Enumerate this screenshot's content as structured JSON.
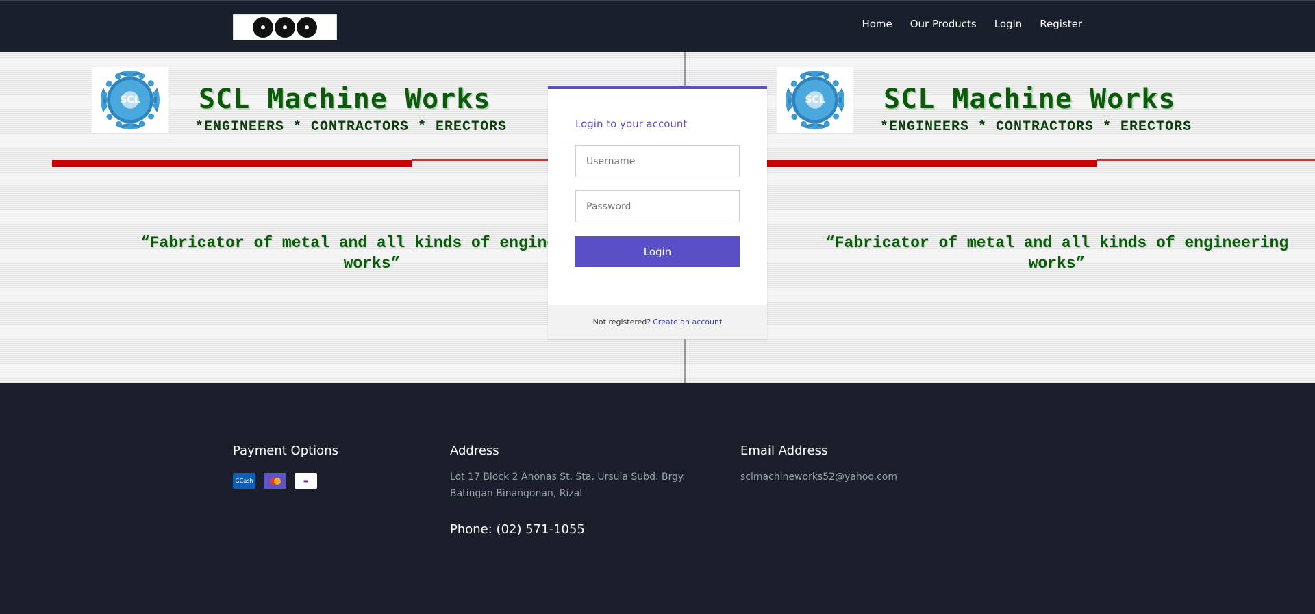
{
  "nav": {
    "items": [
      {
        "label": "Home"
      },
      {
        "label": "Our Products"
      },
      {
        "label": "Login"
      },
      {
        "label": "Register"
      }
    ]
  },
  "hero": {
    "title": "SCL Machine Works",
    "subtitle": "*ENGINEERS * CONTRACTORS * ERECTORS",
    "quote": "“Fabricator of metal and all kinds of engineering works”",
    "badge_text": "SCL"
  },
  "login": {
    "heading": "Login to your account",
    "username_placeholder": "Username",
    "password_placeholder": "Password",
    "button_label": "Login",
    "footer_text": "Not registered?",
    "footer_link": "Create an account",
    "accent_color": "#5b4fc8"
  },
  "footer": {
    "payment": {
      "heading": "Payment Options",
      "icons": [
        "gcash-icon",
        "mastercard-icon",
        "palawan-express-icon"
      ],
      "gcash_label": "GCash"
    },
    "address": {
      "heading": "Address",
      "text": "Lot 17 Block 2 Anonas St. Sta. Ursula Subd. Brgy. Batingan Binangonan, Rizal",
      "phone": "Phone: (02) 571-1055"
    },
    "email": {
      "heading": "Email Address",
      "value": "sclmachineworks52@yahoo.com"
    }
  }
}
